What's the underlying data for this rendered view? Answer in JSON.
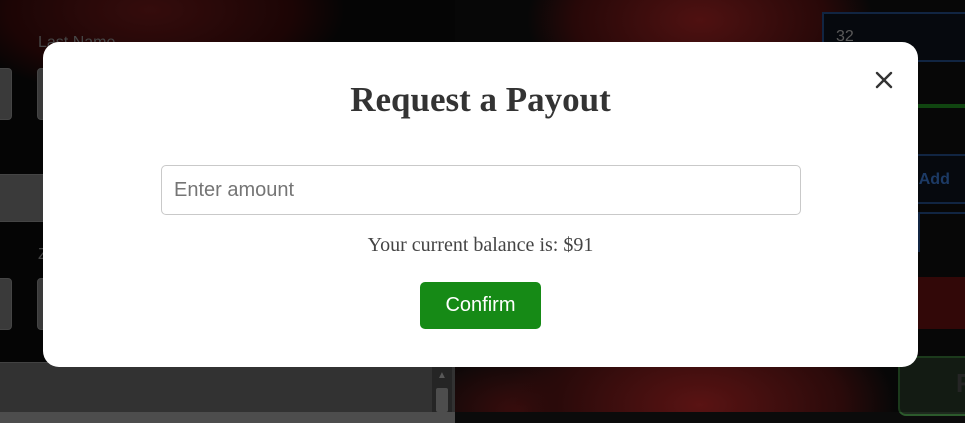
{
  "background_page": {
    "last_name_label": "Last Name",
    "zip_label": "Z",
    "age_value": "32",
    "email_placeholder": "il Add",
    "submit_label": "R"
  },
  "modal": {
    "title": "Request a Payout",
    "close_icon": "close-icon",
    "amount_placeholder": "Enter amount",
    "amount_value": "",
    "balance_text": "Your current balance is: $91",
    "confirm_label": "Confirm"
  },
  "colors": {
    "confirm_button": "#168a16",
    "modal_background": "#ffffff",
    "title_text": "#333333"
  }
}
